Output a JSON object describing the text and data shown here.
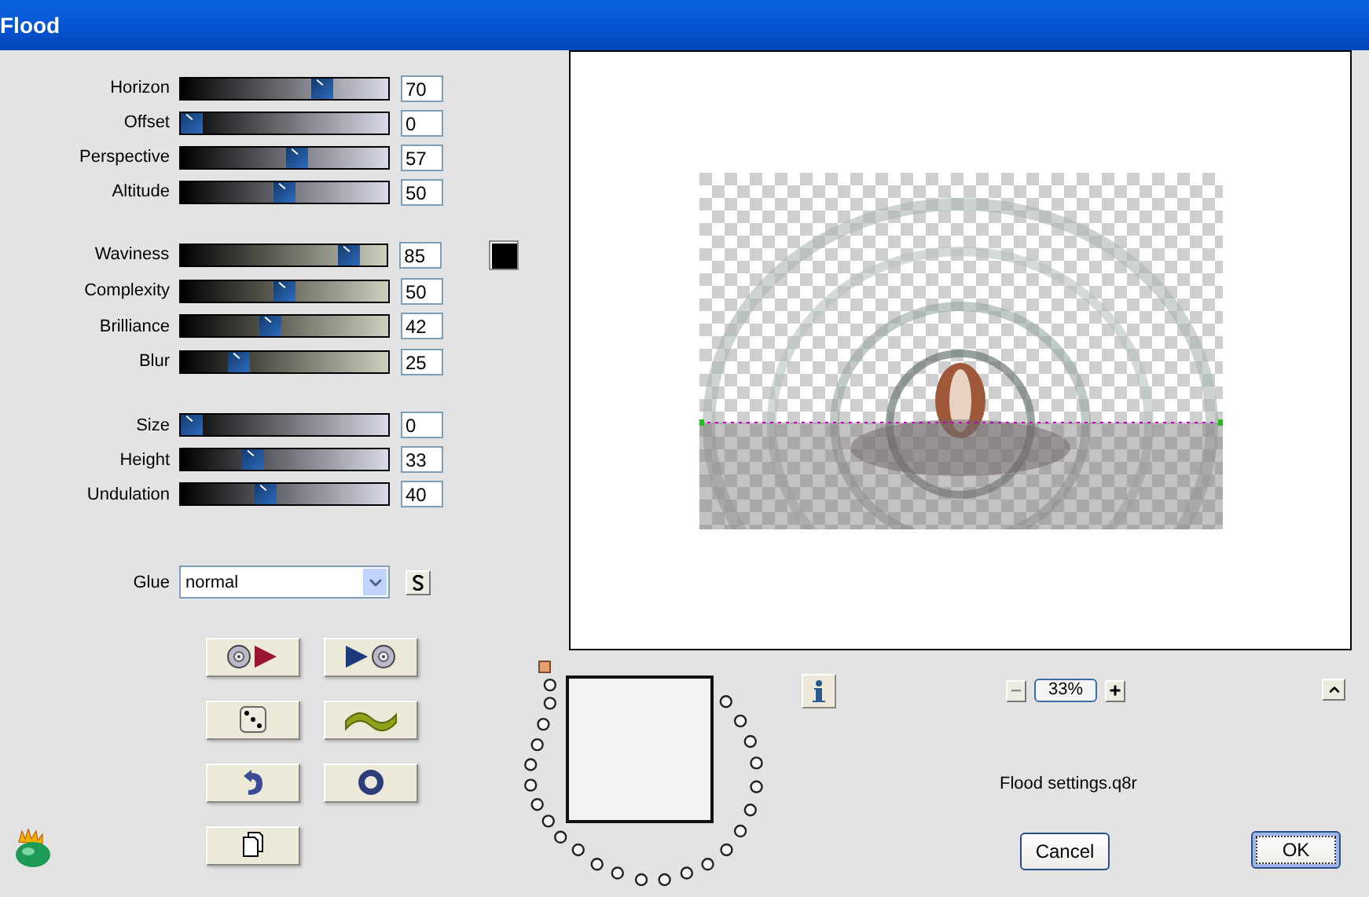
{
  "window": {
    "title": "Flood"
  },
  "slider_groups": [
    {
      "kind": "cool",
      "sliders": [
        {
          "label": "Horizon",
          "level": 0.7,
          "value": "70"
        },
        {
          "label": "Offset",
          "level": 0,
          "value": "0"
        },
        {
          "label": "Perspective",
          "level": 0.57,
          "value": "57"
        },
        {
          "label": "Altitude",
          "level": 0.5,
          "value": "50"
        }
      ]
    },
    {
      "kind": "warm",
      "sliders": [
        {
          "label": "Waviness",
          "level": 0.85,
          "value": "85"
        },
        {
          "label": "Complexity",
          "level": 0.5,
          "value": "50"
        },
        {
          "label": "Brilliance",
          "level": 0.42,
          "value": "42"
        },
        {
          "label": "Blur",
          "level": 0.25,
          "value": "25"
        }
      ]
    },
    {
      "kind": "cool",
      "sliders": [
        {
          "label": "Size",
          "level": 0,
          "value": "0"
        },
        {
          "label": "Height",
          "level": 0.33,
          "value": "33"
        },
        {
          "label": "Undulation",
          "level": 0.4,
          "value": "40"
        }
      ]
    }
  ],
  "glue": {
    "label": "Glue",
    "value": "normal"
  },
  "zoom": "33%",
  "preset_file": "Flood settings.q8r",
  "dialog_buttons": [
    {
      "label": "Cancel",
      "focused": false
    },
    {
      "label": "OK",
      "focused": true
    }
  ]
}
